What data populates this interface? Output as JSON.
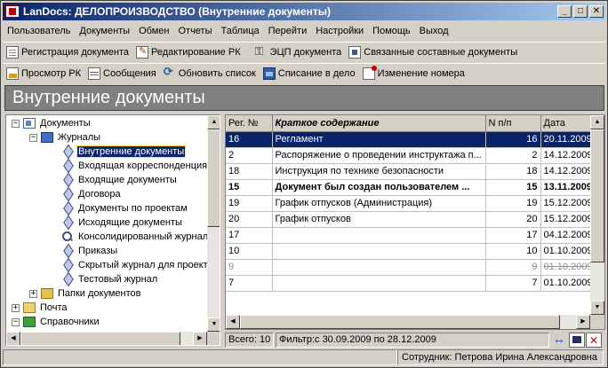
{
  "window": {
    "title": "LanDocs: ДЕЛОПРОИЗВОДСТВО (Внутренние документы)",
    "controls": {
      "minimize": "_",
      "maximize": "□",
      "close": "✕"
    }
  },
  "menu": [
    "Пользователь",
    "Документы",
    "Обмен",
    "Отчеты",
    "Таблица",
    "Перейти",
    "Настройки",
    "Помощь",
    "Выход"
  ],
  "toolbar1": [
    {
      "label": "Регистрация документа",
      "icon": "register-doc-icon"
    },
    {
      "label": "Редактирование РК",
      "icon": "edit-card-icon"
    },
    {
      "label": "ЭЦП документа",
      "icon": "digital-signature-icon"
    },
    {
      "label": "Связанные составные документы",
      "icon": "linked-docs-icon"
    }
  ],
  "toolbar2": [
    {
      "label": "Просмотр РК",
      "icon": "view-card-icon"
    },
    {
      "label": "Сообщения",
      "icon": "messages-icon"
    },
    {
      "label": "Обновить список",
      "icon": "refresh-icon"
    },
    {
      "label": "Списание в дело",
      "icon": "archive-icon"
    },
    {
      "label": "Изменение номера",
      "icon": "change-number-icon"
    }
  ],
  "header": {
    "title": "Внутренние документы"
  },
  "tree": [
    {
      "label": "Документы",
      "level": 0,
      "expander": "−",
      "icon": "docs"
    },
    {
      "label": "Журналы",
      "level": 1,
      "expander": "−",
      "icon": "journals"
    },
    {
      "label": "Внутренние документы",
      "level": 2,
      "icon": "diamond",
      "selected": true
    },
    {
      "label": "Входящая корреспонденция",
      "level": 2,
      "icon": "diamond"
    },
    {
      "label": "Входящие документы",
      "level": 2,
      "icon": "diamond"
    },
    {
      "label": "Договора",
      "level": 2,
      "icon": "diamond"
    },
    {
      "label": "Документы по проектам",
      "level": 2,
      "icon": "diamond"
    },
    {
      "label": "Исходящие документы",
      "level": 2,
      "icon": "diamond"
    },
    {
      "label": "Консолидированный журнал",
      "level": 2,
      "icon": "search"
    },
    {
      "label": "Приказы",
      "level": 2,
      "icon": "diamond"
    },
    {
      "label": "Скрытый журнал для проектов",
      "level": 2,
      "icon": "diamond"
    },
    {
      "label": "Тестовый журнал",
      "level": 2,
      "icon": "diamond"
    },
    {
      "label": "Папки документов",
      "level": 1,
      "expander": "+",
      "icon": "folder"
    },
    {
      "label": "Почта",
      "level": 0,
      "expander": "+",
      "icon": "mail"
    },
    {
      "label": "Справочники",
      "level": 0,
      "expander": "−",
      "icon": "book"
    }
  ],
  "grid": {
    "columns": [
      "Рег. №",
      "Краткое содержание",
      "N п/п",
      "Дата"
    ],
    "rows": [
      {
        "reg": "16",
        "summary": "Регламент",
        "n": "16",
        "date": "20.11.2009",
        "state": "selected"
      },
      {
        "reg": "2",
        "summary": "Распоряжение о проведении инструктажа п...",
        "n": "2",
        "date": "14.12.2009",
        "state": ""
      },
      {
        "reg": "18",
        "summary": "Инструкция по технике безопасности",
        "n": "18",
        "date": "14.12.2009",
        "state": ""
      },
      {
        "reg": "15",
        "summary": "Документ был создан пользователем ...",
        "n": "15",
        "date": "13.11.2009",
        "state": "bold"
      },
      {
        "reg": "19",
        "summary": "График отпусков (Администрация)",
        "n": "19",
        "date": "15.12.2009",
        "state": ""
      },
      {
        "reg": "20",
        "summary": "График отпусков",
        "n": "20",
        "date": "15.12.2009",
        "state": ""
      },
      {
        "reg": "17",
        "summary": "",
        "n": "17",
        "date": "04.12.2009",
        "state": ""
      },
      {
        "reg": "10",
        "summary": "",
        "n": "10",
        "date": "01.10.2009",
        "state": ""
      },
      {
        "reg": "9",
        "summary": "",
        "n": "9",
        "date": "01.10.2009",
        "state": "struck"
      },
      {
        "reg": "7",
        "summary": "",
        "n": "7",
        "date": "01.10.2009",
        "state": ""
      }
    ]
  },
  "grid_footer": {
    "total": "Всего: 10",
    "filter": "Фильтр:с 30.09.2009 по 28.12.2009"
  },
  "status": {
    "left": "",
    "user": "Сотрудник: Петрова Ирина Александровна"
  }
}
